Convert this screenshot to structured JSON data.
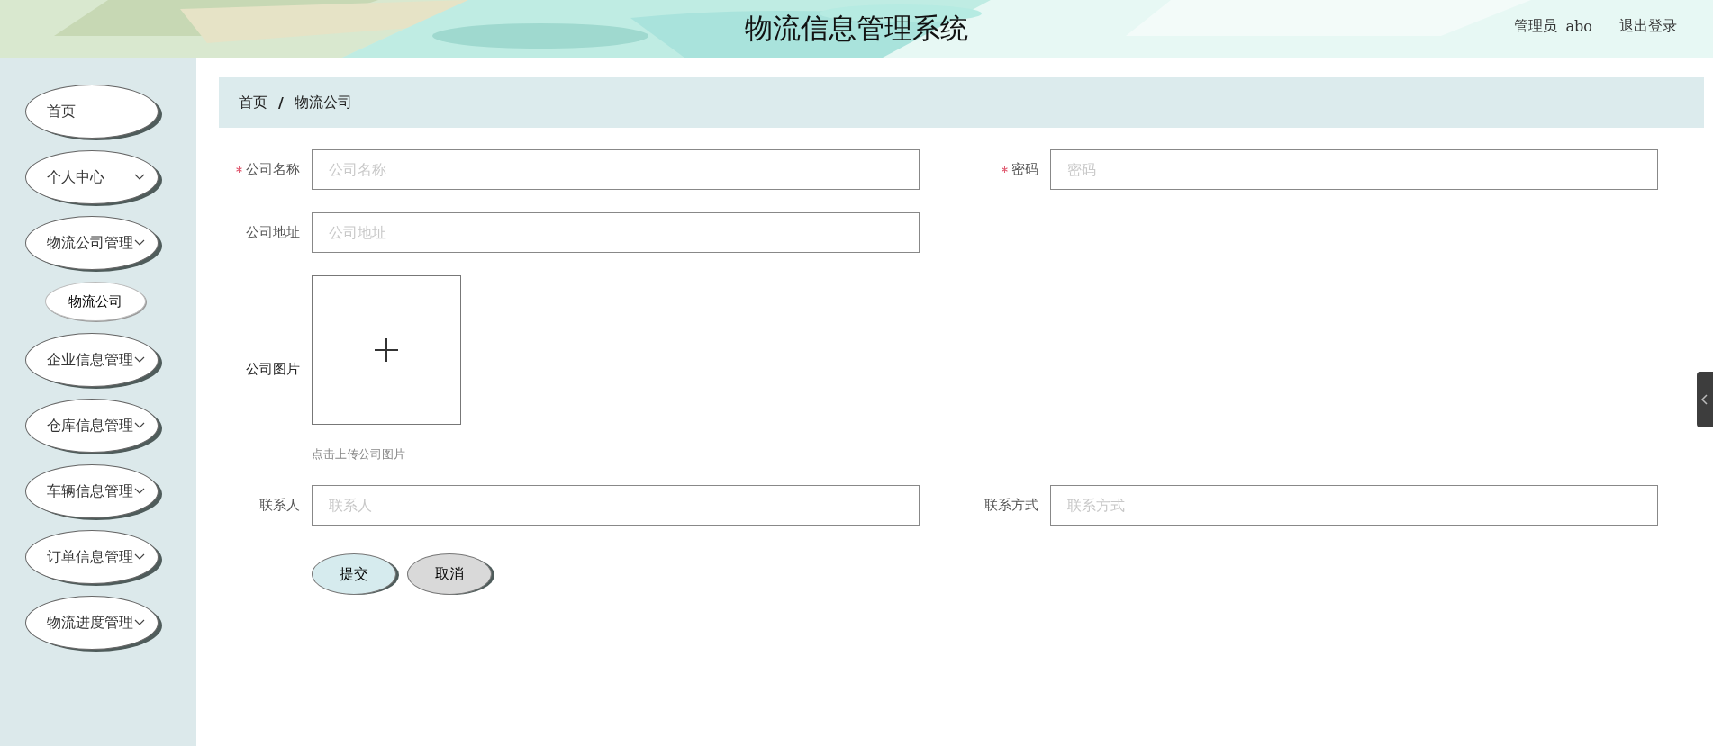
{
  "header": {
    "title": "物流信息管理系统",
    "user_role": "管理员",
    "user_name": "abo",
    "logout": "退出登录"
  },
  "sidebar": {
    "items": [
      {
        "label": "首页",
        "expandable": false,
        "selected": false
      },
      {
        "label": "个人中心",
        "expandable": true,
        "selected": false
      },
      {
        "label": "物流公司管理",
        "expandable": true,
        "selected": false,
        "children": [
          {
            "label": "物流公司",
            "selected": true
          }
        ]
      },
      {
        "label": "企业信息管理",
        "expandable": true,
        "selected": false
      },
      {
        "label": "仓库信息管理",
        "expandable": true,
        "selected": false
      },
      {
        "label": "车辆信息管理",
        "expandable": true,
        "selected": false
      },
      {
        "label": "订单信息管理",
        "expandable": true,
        "selected": false
      },
      {
        "label": "物流进度管理",
        "expandable": true,
        "selected": false
      }
    ]
  },
  "breadcrumb": {
    "items": [
      "首页",
      "物流公司"
    ],
    "separator": "/"
  },
  "form": {
    "rows": [
      [
        {
          "kind": "text",
          "label": "公司名称",
          "required": true,
          "placeholder": "公司名称"
        },
        {
          "kind": "text",
          "label": "密码",
          "required": true,
          "placeholder": "密码"
        }
      ],
      [
        {
          "kind": "text",
          "label": "公司地址",
          "required": false,
          "placeholder": "公司地址"
        }
      ],
      [
        {
          "kind": "upload",
          "label": "公司图片",
          "required": false,
          "hint": "点击上传公司图片"
        }
      ],
      [
        {
          "kind": "text",
          "label": "联系人",
          "required": false,
          "placeholder": "联系人"
        },
        {
          "kind": "text",
          "label": "联系方式",
          "required": false,
          "placeholder": "联系方式"
        }
      ]
    ],
    "buttons": [
      {
        "label": "提交",
        "kind": "primary"
      },
      {
        "label": "取消",
        "kind": "default"
      }
    ]
  }
}
